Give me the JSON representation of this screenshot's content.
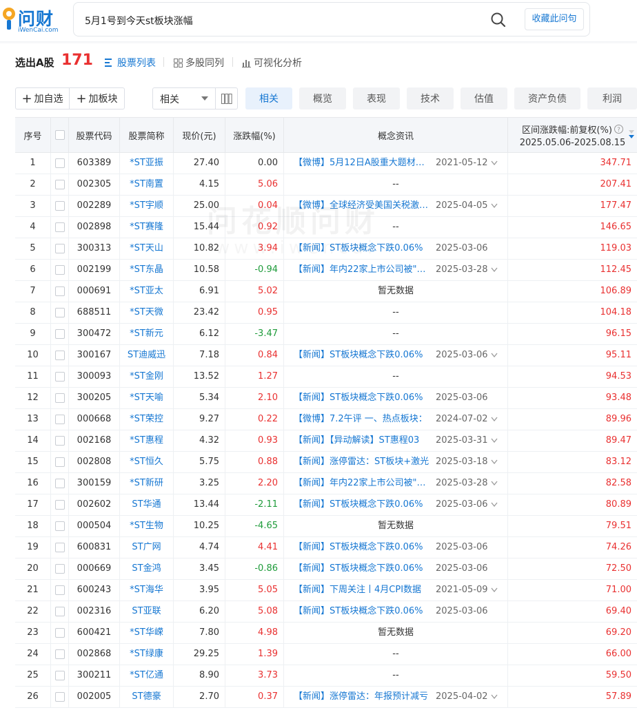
{
  "header": {
    "logo_text": "问财",
    "logo_sub": "iWenCai.com",
    "query": "5月1号到今天st板块涨幅",
    "fav_label": "收藏此问句"
  },
  "result": {
    "label": "选出A股",
    "count": "171",
    "views": [
      "股票列表",
      "多股同列",
      "可视化分析"
    ]
  },
  "toolbar": {
    "add_watch": "加自选",
    "add_block": "加板块",
    "sort_value": "相关",
    "tabs": [
      "相关",
      "概览",
      "表现",
      "技术",
      "估值",
      "资产负债",
      "利润"
    ]
  },
  "columns": {
    "seq": "序号",
    "code": "股票代码",
    "name": "股票简称",
    "price": "现价(元)",
    "chg": "涨跌幅(%)",
    "news": "概念资讯",
    "range_title": "区间涨跌幅:前复权(%)",
    "range_dates": "2025.05.06-2025.08.15"
  },
  "watermark": {
    "line1": "问花顺问财",
    "line2": "www.iwencai"
  },
  "rows": [
    {
      "seq": "1",
      "code": "603389",
      "name": "*ST亚振",
      "price": "27.40",
      "chg": "0.00",
      "dir": "flat",
      "news": "【微博】5月12日A股重大题材资讯",
      "date": "2021-05-12",
      "chev": true,
      "range": "347.71"
    },
    {
      "seq": "2",
      "code": "002305",
      "name": "*ST南置",
      "price": "4.15",
      "chg": "5.06",
      "dir": "up",
      "news": "--",
      "date": "",
      "chev": false,
      "range": "207.41"
    },
    {
      "seq": "3",
      "code": "002289",
      "name": "*ST宇顺",
      "price": "25.00",
      "chg": "0.04",
      "dir": "up",
      "news": "【微博】全球经济受美国关税激增影响",
      "date": "2025-04-05",
      "chev": true,
      "range": "177.47"
    },
    {
      "seq": "4",
      "code": "002898",
      "name": "*ST赛隆",
      "price": "15.44",
      "chg": "0.92",
      "dir": "up",
      "news": "--",
      "date": "",
      "chev": false,
      "range": "146.65"
    },
    {
      "seq": "5",
      "code": "300313",
      "name": "*ST天山",
      "price": "10.82",
      "chg": "3.94",
      "dir": "up",
      "news": "【新闻】ST板块概念下跌0.06%",
      "date": "2025-03-06",
      "chev": false,
      "range": "119.03"
    },
    {
      "seq": "6",
      "code": "002199",
      "name": "*ST东晶",
      "price": "10.58",
      "chg": "-0.94",
      "dir": "down",
      "news": "【新闻】年内22家上市公司被\"戴帽\"",
      "date": "2025-03-28",
      "chev": true,
      "range": "112.45"
    },
    {
      "seq": "7",
      "code": "000691",
      "name": "*ST亚太",
      "price": "6.91",
      "chg": "5.02",
      "dir": "up",
      "news": "暂无数据",
      "date": "",
      "chev": false,
      "range": "106.89"
    },
    {
      "seq": "8",
      "code": "688511",
      "name": "*ST天微",
      "price": "23.42",
      "chg": "0.95",
      "dir": "up",
      "news": "--",
      "date": "",
      "chev": false,
      "range": "104.18"
    },
    {
      "seq": "9",
      "code": "300472",
      "name": "*ST新元",
      "price": "6.12",
      "chg": "-3.47",
      "dir": "down",
      "news": "--",
      "date": "",
      "chev": false,
      "range": "96.15"
    },
    {
      "seq": "10",
      "code": "300167",
      "name": "ST迪威迅",
      "price": "7.18",
      "chg": "0.84",
      "dir": "up",
      "news": "【新闻】ST板块概念下跌0.06%",
      "date": "2025-03-06",
      "chev": true,
      "range": "95.11"
    },
    {
      "seq": "11",
      "code": "300093",
      "name": "*ST金刚",
      "price": "13.52",
      "chg": "1.27",
      "dir": "up",
      "news": "--",
      "date": "",
      "chev": false,
      "range": "94.53"
    },
    {
      "seq": "12",
      "code": "300205",
      "name": "*ST天喻",
      "price": "5.34",
      "chg": "2.10",
      "dir": "up",
      "news": "【新闻】ST板块概念下跌0.06%",
      "date": "2025-03-06",
      "chev": false,
      "range": "93.48"
    },
    {
      "seq": "13",
      "code": "000668",
      "name": "*ST荣控",
      "price": "9.27",
      "chg": "0.22",
      "dir": "up",
      "news": "【微博】7.2午评 一、热点板块：",
      "date": "2024-07-02",
      "chev": true,
      "range": "89.96"
    },
    {
      "seq": "14",
      "code": "002168",
      "name": "*ST惠程",
      "price": "4.32",
      "chg": "0.93",
      "dir": "up",
      "news": "【新闻】【异动解读】ST惠程03",
      "date": "2025-03-31",
      "chev": true,
      "range": "89.47"
    },
    {
      "seq": "15",
      "code": "002808",
      "name": "*ST恒久",
      "price": "5.75",
      "chg": "0.88",
      "dir": "up",
      "news": "【新闻】涨停雷达：ST板块+激光",
      "date": "2025-03-18",
      "chev": true,
      "range": "83.12"
    },
    {
      "seq": "16",
      "code": "300159",
      "name": "*ST新研",
      "price": "3.25",
      "chg": "2.20",
      "dir": "up",
      "news": "【新闻】年内22家上市公司被\"戴帽\"",
      "date": "2025-03-28",
      "chev": true,
      "range": "82.58"
    },
    {
      "seq": "17",
      "code": "002602",
      "name": "ST华通",
      "price": "13.44",
      "chg": "-2.11",
      "dir": "down",
      "news": "【新闻】ST板块概念下跌0.06%",
      "date": "2025-03-06",
      "chev": true,
      "range": "80.89"
    },
    {
      "seq": "18",
      "code": "000504",
      "name": "*ST生物",
      "price": "10.25",
      "chg": "-4.65",
      "dir": "down",
      "news": "暂无数据",
      "date": "",
      "chev": false,
      "range": "79.51"
    },
    {
      "seq": "19",
      "code": "600831",
      "name": "ST广网",
      "price": "4.74",
      "chg": "4.41",
      "dir": "up",
      "news": "【新闻】ST板块概念下跌0.06%",
      "date": "2025-03-06",
      "chev": false,
      "range": "74.26"
    },
    {
      "seq": "20",
      "code": "000669",
      "name": "ST金鸿",
      "price": "3.45",
      "chg": "-0.86",
      "dir": "down",
      "news": "【新闻】ST板块概念下跌0.06%",
      "date": "2025-03-06",
      "chev": false,
      "range": "72.50"
    },
    {
      "seq": "21",
      "code": "600243",
      "name": "*ST海华",
      "price": "3.95",
      "chg": "5.05",
      "dir": "up",
      "news": "【新闻】下周关注丨4月CPI数据",
      "date": "2021-05-09",
      "chev": true,
      "range": "71.00"
    },
    {
      "seq": "22",
      "code": "002316",
      "name": "ST亚联",
      "price": "6.20",
      "chg": "5.08",
      "dir": "up",
      "news": "【新闻】ST板块概念下跌0.06%",
      "date": "2025-03-06",
      "chev": false,
      "range": "69.40"
    },
    {
      "seq": "23",
      "code": "600421",
      "name": "*ST华嵘",
      "price": "7.80",
      "chg": "4.98",
      "dir": "up",
      "news": "暂无数据",
      "date": "",
      "chev": false,
      "range": "69.20"
    },
    {
      "seq": "24",
      "code": "002868",
      "name": "*ST绿康",
      "price": "29.25",
      "chg": "1.39",
      "dir": "up",
      "news": "--",
      "date": "",
      "chev": false,
      "range": "66.00"
    },
    {
      "seq": "25",
      "code": "300211",
      "name": "*ST亿通",
      "price": "8.90",
      "chg": "3.73",
      "dir": "up",
      "news": "--",
      "date": "",
      "chev": false,
      "range": "59.50"
    },
    {
      "seq": "26",
      "code": "002005",
      "name": "ST德豪",
      "price": "2.70",
      "chg": "0.37",
      "dir": "up",
      "news": "【新闻】涨停雷达：年报预计减亏",
      "date": "2025-04-02",
      "chev": true,
      "range": "57.89"
    }
  ]
}
